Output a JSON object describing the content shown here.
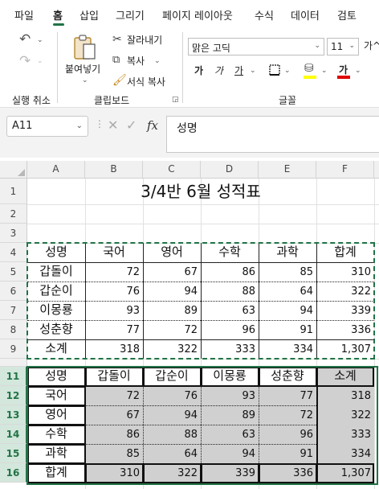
{
  "menu": {
    "tabs": [
      "파일",
      "홈",
      "삽입",
      "그리기",
      "페이지 레이아웃",
      "수식",
      "데이터",
      "검토"
    ]
  },
  "ribbon": {
    "undo_group_label": "실행 취소",
    "paste_label": "붙여넣기",
    "cut_label": "잘라내기",
    "copy_label": "복사",
    "format_painter_label": "서식 복사",
    "clipboard_group_label": "클립보드",
    "font_name": "맑은 고딕",
    "font_size": "11",
    "grow_font_label": "가^",
    "bold_label": "가",
    "italic_label": "가",
    "underline_label": "가",
    "font_color_label": "가",
    "font_group_label": "글꼴"
  },
  "formula_bar": {
    "name_box": "A11",
    "fx_label": "fx",
    "formula": "성명"
  },
  "sheet": {
    "columns": [
      "A",
      "B",
      "C",
      "D",
      "E",
      "F"
    ],
    "rows": [
      "1",
      "2",
      "3",
      "4",
      "5",
      "6",
      "7",
      "8",
      "9",
      "10",
      "11",
      "12",
      "13",
      "14",
      "15",
      "16"
    ],
    "title": "3/4반 6월 성적표",
    "table1": {
      "headers": [
        "성명",
        "국어",
        "영어",
        "수학",
        "과학",
        "합계"
      ],
      "rows": [
        [
          "갑돌이",
          "72",
          "67",
          "86",
          "85",
          "310"
        ],
        [
          "갑순이",
          "76",
          "94",
          "88",
          "64",
          "322"
        ],
        [
          "이몽룡",
          "93",
          "89",
          "63",
          "94",
          "339"
        ],
        [
          "성춘향",
          "77",
          "72",
          "96",
          "91",
          "336"
        ],
        [
          "소계",
          "318",
          "322",
          "333",
          "334",
          "1,307"
        ]
      ]
    },
    "table2": {
      "headers": [
        "성명",
        "갑돌이",
        "갑순이",
        "이몽룡",
        "성춘향",
        "소계"
      ],
      "rows": [
        [
          "국어",
          "72",
          "76",
          "93",
          "77",
          "318"
        ],
        [
          "영어",
          "67",
          "94",
          "89",
          "72",
          "322"
        ],
        [
          "수학",
          "86",
          "88",
          "63",
          "96",
          "333"
        ],
        [
          "과학",
          "85",
          "64",
          "94",
          "91",
          "334"
        ],
        [
          "합계",
          "310",
          "322",
          "339",
          "336",
          "1,307"
        ]
      ]
    }
  },
  "colors": {
    "accent": "#217346",
    "shade": "#d0d0d0",
    "fill_color_bar": "#ffff00",
    "font_color_bar": "#e00000"
  }
}
